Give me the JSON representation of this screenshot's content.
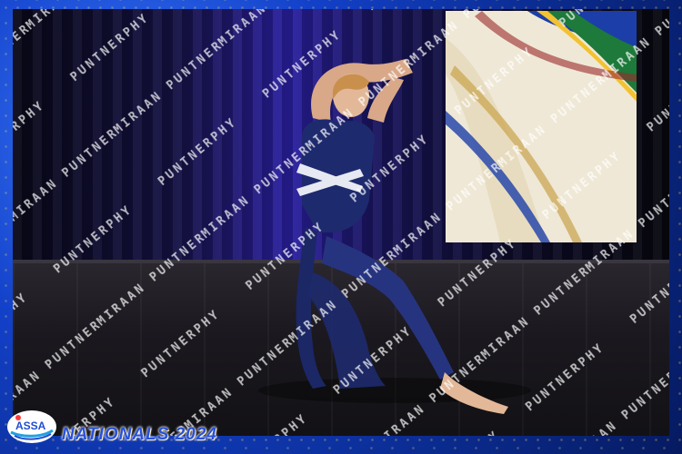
{
  "event": {
    "title": "NATIONALS 2024",
    "logo_text": "ASSA"
  },
  "watermark": {
    "text": "MIRAAN PUNTNERPHY"
  },
  "colors": {
    "frame_blue": "#1240c8",
    "sparkle_gold": "#ffd25a",
    "costume_navy": "#1e2a6e",
    "curtain_purple": "#2a1fa0"
  }
}
